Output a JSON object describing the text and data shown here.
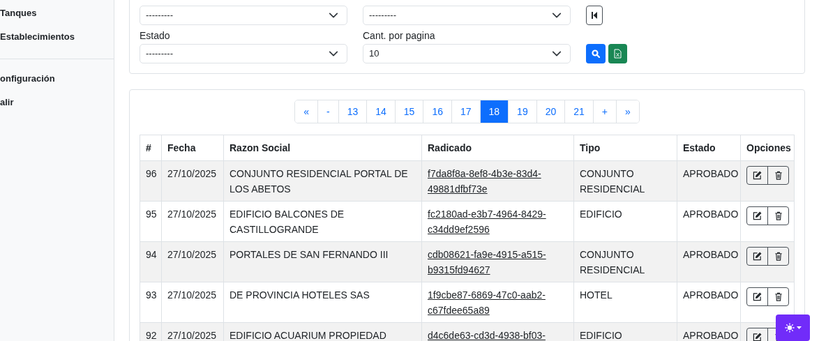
{
  "sidebar": {
    "items": [
      {
        "label": "Tanques"
      },
      {
        "label": "Establecimientos"
      },
      {
        "label": "onfiguración",
        "divider_before": true
      },
      {
        "label": "alir"
      }
    ]
  },
  "filters": {
    "top_selects": [
      {
        "value": "---------"
      },
      {
        "value": "---------"
      }
    ],
    "fields": [
      {
        "label": "Estado",
        "value": "---------"
      },
      {
        "label": "Cant. por pagina",
        "value": "10"
      }
    ]
  },
  "pagination": [
    {
      "label": "«",
      "selected": false
    },
    {
      "label": "-",
      "selected": false
    },
    {
      "label": "13",
      "selected": false
    },
    {
      "label": "14",
      "selected": false
    },
    {
      "label": "15",
      "selected": false
    },
    {
      "label": "16",
      "selected": false
    },
    {
      "label": "17",
      "selected": false
    },
    {
      "label": "18",
      "selected": true
    },
    {
      "label": "19",
      "selected": false
    },
    {
      "label": "20",
      "selected": false
    },
    {
      "label": "21",
      "selected": false
    },
    {
      "label": "+",
      "selected": false
    },
    {
      "label": "»",
      "selected": false
    }
  ],
  "table": {
    "columns": [
      "#",
      "Fecha",
      "Razon Social",
      "Radicado",
      "Tipo",
      "Estado",
      "Opciones"
    ],
    "rows": [
      {
        "num": "96",
        "fecha": "27/10/2025",
        "razon": "CONJUNTO RESIDENCIAL PORTAL DE LOS ABETOS",
        "radicado": "f7da8f8a-8ef8-4b3e-83d4-49881dfbf73e",
        "tipo": "CONJUNTO RESIDENCIAL",
        "estado": "APROBADO"
      },
      {
        "num": "95",
        "fecha": "27/10/2025",
        "razon": "EDIFICIO BALCONES DE CASTILLOGRANDE",
        "radicado": "fc2180ad-e3b7-4964-8429-c34dd9ef2596",
        "tipo": "EDIFICIO",
        "estado": "APROBADO"
      },
      {
        "num": "94",
        "fecha": "27/10/2025",
        "razon": "PORTALES DE SAN FERNANDO III",
        "radicado": "cdb08621-fa9e-4915-a515-b9315fd94627",
        "tipo": "CONJUNTO RESIDENCIAL",
        "estado": "APROBADO"
      },
      {
        "num": "93",
        "fecha": "27/10/2025",
        "razon": "DE PROVINCIA HOTELES SAS",
        "radicado": "1f9cbe87-6869-47c0-aab2-c67fdee65a89",
        "tipo": "HOTEL",
        "estado": "APROBADO"
      },
      {
        "num": "92",
        "fecha": "27/10/2025",
        "razon": "EDIFICIO ACUARIUM PROPIEDAD",
        "radicado": "d4c6de63-cd3d-4938-bf03-",
        "tipo": "EDIFICIO",
        "estado": "APROBADO"
      }
    ]
  }
}
